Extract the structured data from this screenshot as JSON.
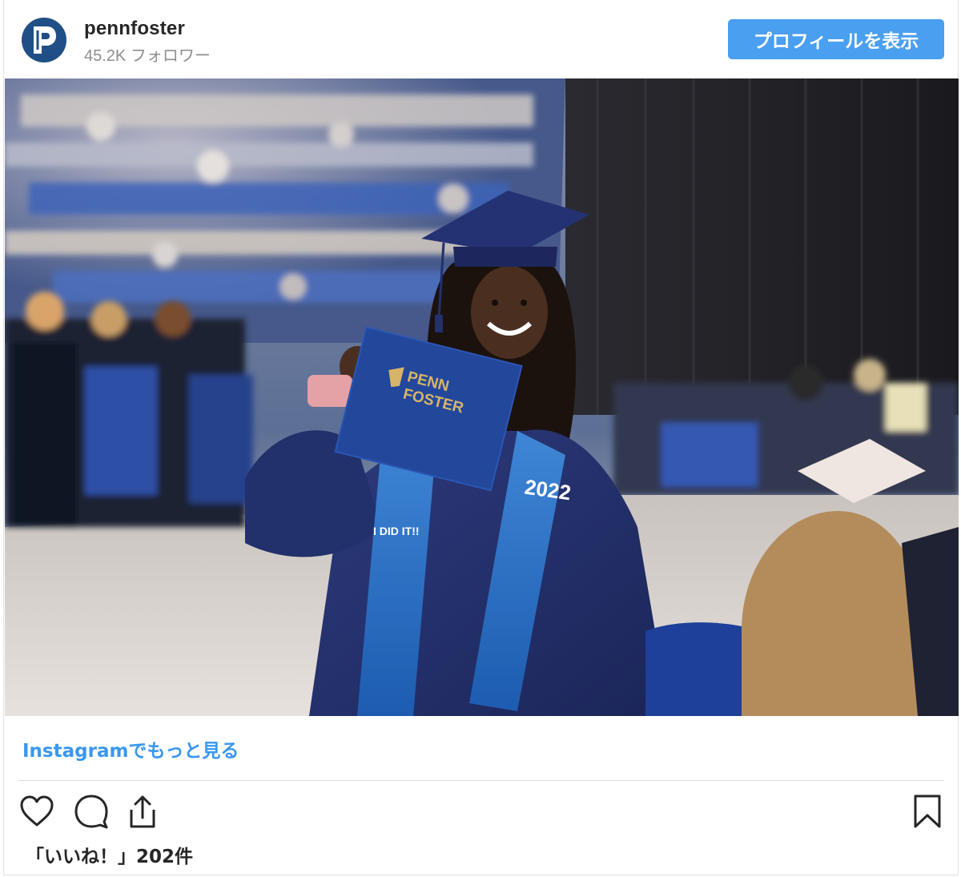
{
  "header": {
    "username": "pennfoster",
    "followers": "45.2K フォロワー",
    "profile_button": "プロフィールを表示",
    "avatar_icon": "penn-foster-logo-icon"
  },
  "post": {
    "image_subject": "graduate-photo",
    "diploma_text_line1": "PENN",
    "diploma_text_line2": "FOSTER",
    "stole_year": "2022",
    "stole_text": "I DID IT!!",
    "more_link": "Instagramでもっと見る",
    "likes": "「いいね！」202件"
  },
  "actions": {
    "like_icon": "heart-icon",
    "comment_icon": "comment-icon",
    "share_icon": "share-icon",
    "save_icon": "bookmark-icon"
  },
  "colors": {
    "accent": "#4a9ff0",
    "link": "#3897f0",
    "brand_navy": "#1f4f86",
    "gown": "#22306b"
  }
}
